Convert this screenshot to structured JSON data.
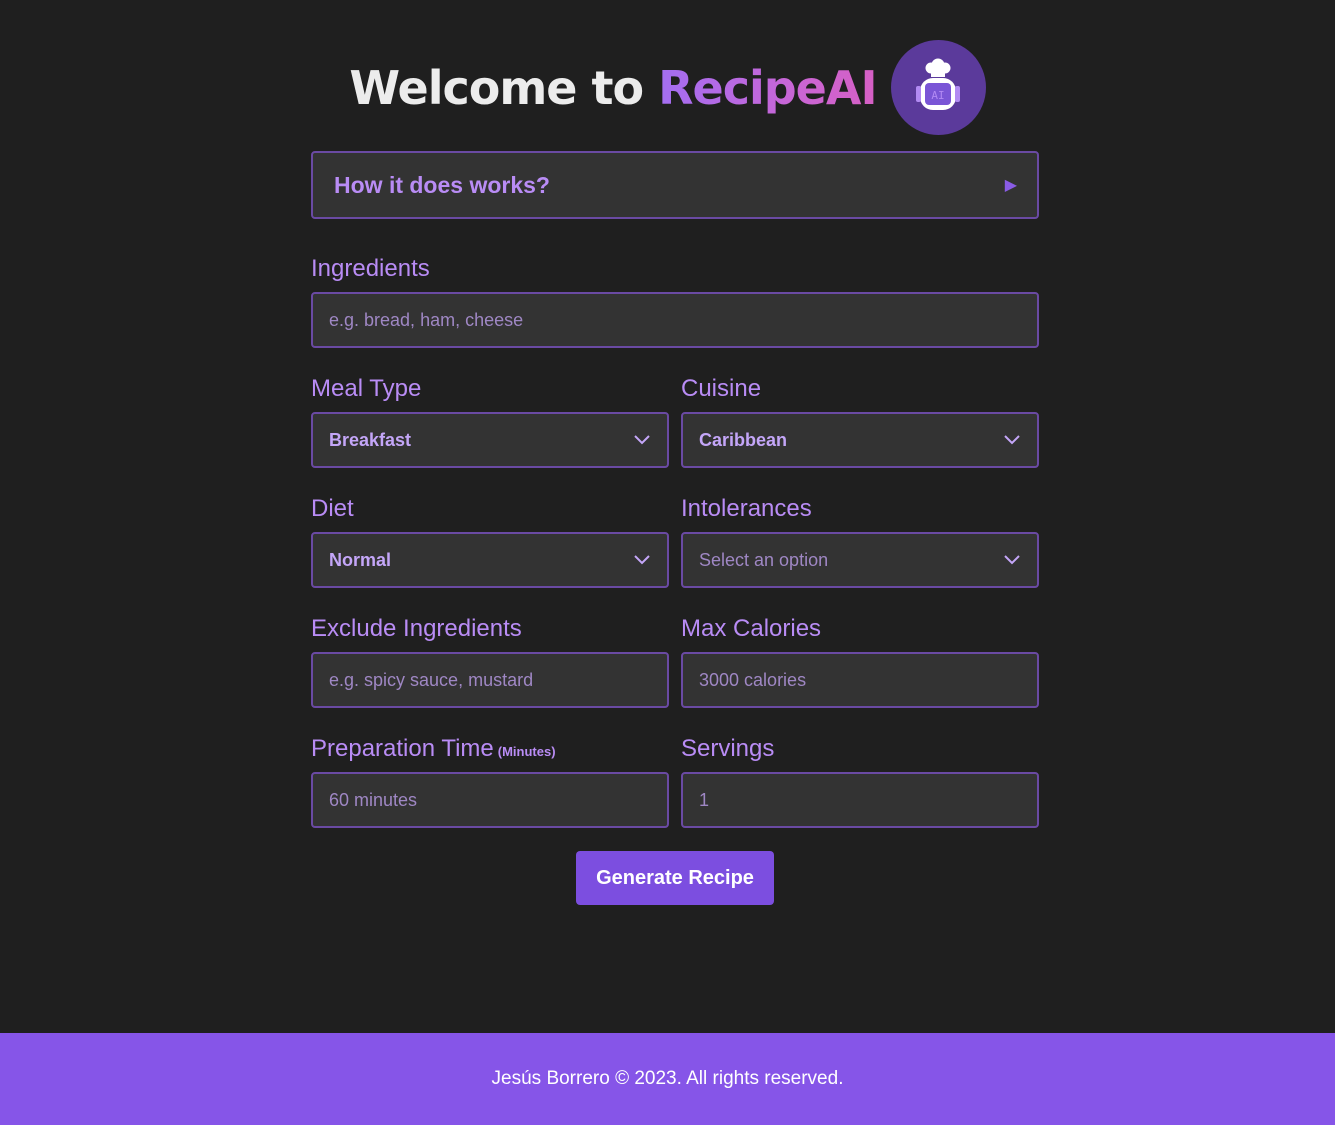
{
  "header": {
    "title_prefix": "Welcome to ",
    "title_brand": "RecipeAI",
    "logo_icon": "chef-robot-icon",
    "logo_text": "AI"
  },
  "accordion": {
    "title": "How it does works?",
    "icon": "triangle-right-icon"
  },
  "form": {
    "ingredients": {
      "label": "Ingredients",
      "placeholder": "e.g. bread, ham, cheese"
    },
    "meal_type": {
      "label": "Meal Type",
      "value": "Breakfast",
      "icon": "chevron-down-icon"
    },
    "cuisine": {
      "label": "Cuisine",
      "value": "Caribbean",
      "icon": "chevron-down-icon"
    },
    "diet": {
      "label": "Diet",
      "value": "Normal",
      "icon": "chevron-down-icon"
    },
    "intolerances": {
      "label": "Intolerances",
      "placeholder": "Select an option",
      "icon": "chevron-down-icon"
    },
    "exclude_ingredients": {
      "label": "Exclude Ingredients",
      "placeholder": "e.g. spicy sauce, mustard"
    },
    "max_calories": {
      "label": "Max Calories",
      "placeholder": "3000 calories"
    },
    "preparation_time": {
      "label": "Preparation Time",
      "unit": "(Minutes)",
      "placeholder": "60 minutes"
    },
    "servings": {
      "label": "Servings",
      "value": "1"
    },
    "submit_label": "Generate Recipe"
  },
  "footer": {
    "text": "Jesús Borrero © 2023. All rights reserved."
  },
  "colors": {
    "background": "#1f1f1f",
    "accent": "#8655e8",
    "label": "#b98cf5",
    "field_bg": "#333333",
    "field_border": "#6a4aa3"
  }
}
